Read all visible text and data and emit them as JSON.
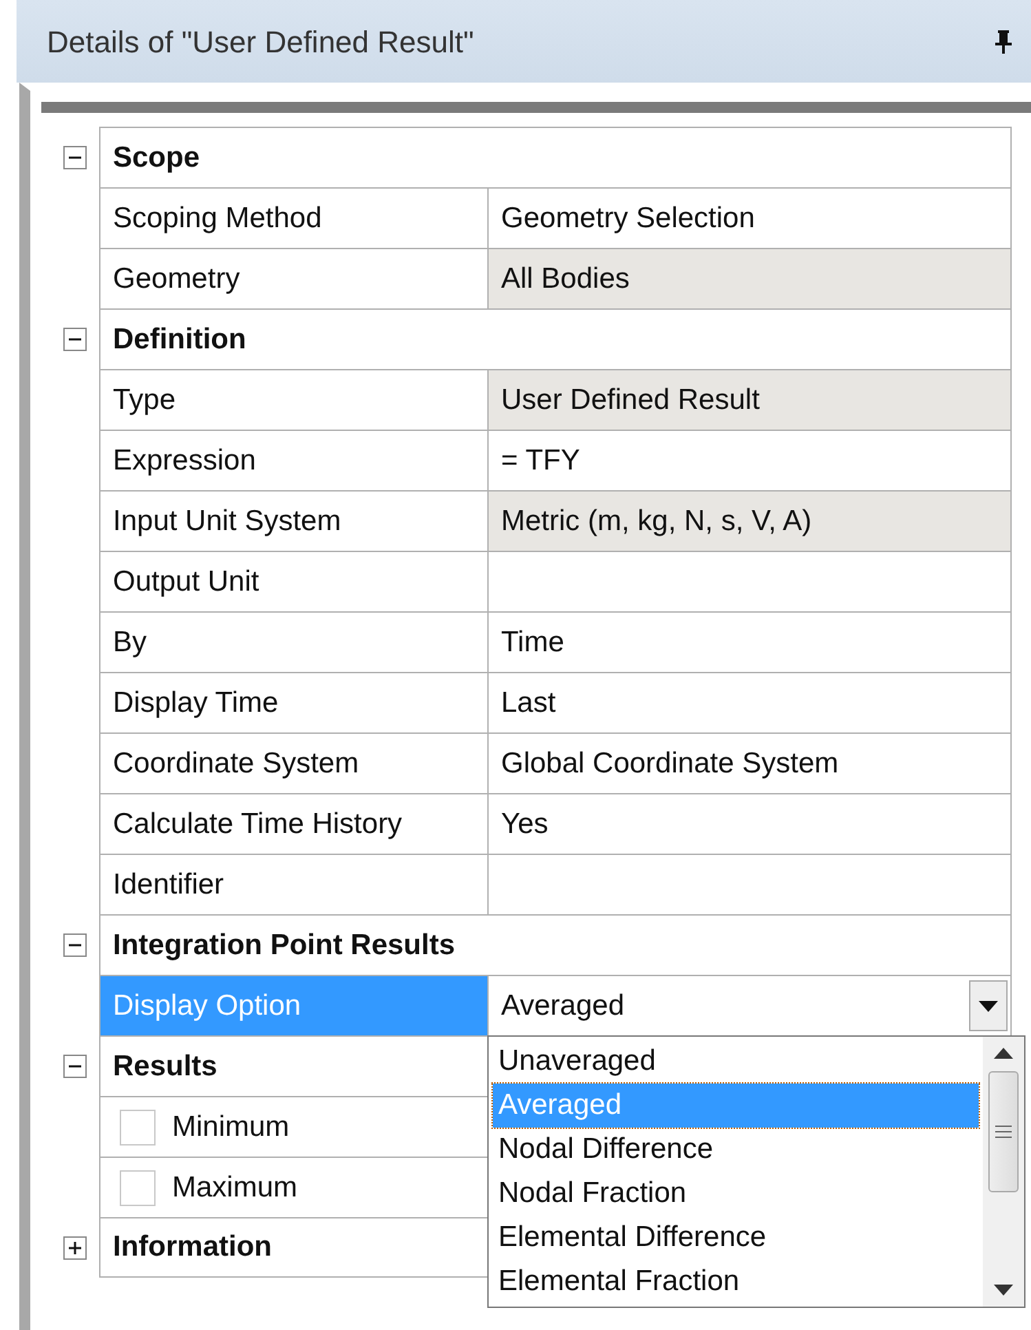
{
  "panel": {
    "title": "Details of \"User Defined Result\""
  },
  "groups": [
    {
      "label": "Scope",
      "expanded": true,
      "rows": [
        {
          "label": "Scoping Method",
          "value": "Geometry Selection",
          "readonly": false,
          "selected": false
        },
        {
          "label": "Geometry",
          "value": "All Bodies",
          "readonly": true,
          "selected": false
        }
      ]
    },
    {
      "label": "Definition",
      "expanded": true,
      "rows": [
        {
          "label": "Type",
          "value": "User Defined Result",
          "readonly": true,
          "selected": false
        },
        {
          "label": "Expression",
          "value": "= TFY",
          "readonly": false,
          "selected": false
        },
        {
          "label": "Input Unit System",
          "value": "Metric (m, kg, N, s, V, A)",
          "readonly": true,
          "selected": false
        },
        {
          "label": "Output Unit",
          "value": "",
          "readonly": false,
          "selected": false
        },
        {
          "label": "By",
          "value": "Time",
          "readonly": false,
          "selected": false
        },
        {
          "label": "Display Time",
          "value": "Last",
          "readonly": false,
          "selected": false
        },
        {
          "label": "Coordinate System",
          "value": "Global Coordinate System",
          "readonly": false,
          "selected": false
        },
        {
          "label": "Calculate Time History",
          "value": "Yes",
          "readonly": false,
          "selected": false
        },
        {
          "label": "Identifier",
          "value": "",
          "readonly": false,
          "selected": false
        }
      ]
    },
    {
      "label": "Integration Point Results",
      "expanded": true,
      "rows": [
        {
          "label": "Display Option",
          "value": "Averaged",
          "readonly": false,
          "selected": true,
          "kind": "dropdown",
          "options": [
            {
              "label": "Unaveraged",
              "selected": false
            },
            {
              "label": "Averaged",
              "selected": true
            },
            {
              "label": "Nodal Difference",
              "selected": false
            },
            {
              "label": "Nodal Fraction",
              "selected": false
            },
            {
              "label": "Elemental Difference",
              "selected": false
            },
            {
              "label": "Elemental Fraction",
              "selected": false
            }
          ]
        }
      ]
    },
    {
      "label": "Results",
      "expanded": true,
      "rows": [
        {
          "label": "Minimum",
          "kind": "checkbox",
          "checked": false,
          "selected": false
        },
        {
          "label": "Maximum",
          "kind": "checkbox",
          "checked": false,
          "selected": false
        }
      ]
    },
    {
      "label": "Information",
      "expanded": false
    }
  ]
}
